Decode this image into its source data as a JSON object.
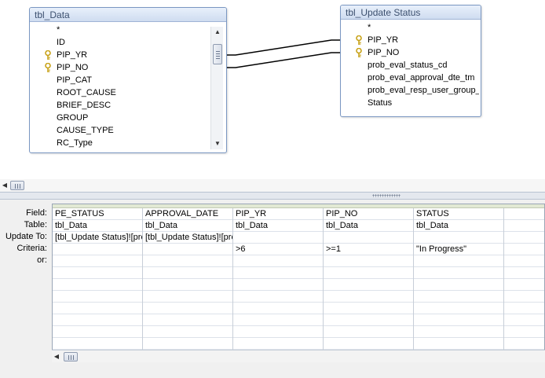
{
  "tables": [
    {
      "title": "tbl_Data",
      "fields": [
        {
          "name": "*",
          "key": false
        },
        {
          "name": "ID",
          "key": false
        },
        {
          "name": "PIP_YR",
          "key": true
        },
        {
          "name": "PIP_NO",
          "key": true
        },
        {
          "name": "PIP_CAT",
          "key": false
        },
        {
          "name": "ROOT_CAUSE",
          "key": false
        },
        {
          "name": "BRIEF_DESC",
          "key": false
        },
        {
          "name": "GROUP",
          "key": false
        },
        {
          "name": "CAUSE_TYPE",
          "key": false
        },
        {
          "name": "RC_Type",
          "key": false
        }
      ]
    },
    {
      "title": "tbl_Update Status",
      "fields": [
        {
          "name": "*",
          "key": false
        },
        {
          "name": "PIP_YR",
          "key": true
        },
        {
          "name": "PIP_NO",
          "key": true
        },
        {
          "name": "prob_eval_status_cd",
          "key": false
        },
        {
          "name": "prob_eval_approval_dte_tm",
          "key": false
        },
        {
          "name": "prob_eval_resp_user_group_",
          "key": false
        },
        {
          "name": "Status",
          "key": false
        }
      ]
    }
  ],
  "grid": {
    "row_labels": [
      "Field:",
      "Table:",
      "Update To:",
      "Criteria:",
      "or:"
    ],
    "columns": [
      {
        "field": "PE_STATUS",
        "table": "tbl_Data",
        "update_to": "[tbl_Update Status]![prob_eval_status_cd]",
        "criteria": "",
        "or": ""
      },
      {
        "field": "APPROVAL_DATE",
        "table": "tbl_Data",
        "update_to": "[tbl_Update Status]![prob_eval_approval_dte_tm]",
        "criteria": "",
        "or": ""
      },
      {
        "field": "PIP_YR",
        "table": "tbl_Data",
        "update_to": "",
        "criteria": ">6",
        "or": ""
      },
      {
        "field": "PIP_NO",
        "table": "tbl_Data",
        "update_to": "",
        "criteria": ">=1",
        "or": ""
      },
      {
        "field": "STATUS",
        "table": "tbl_Data",
        "update_to": "",
        "criteria": "\"In Progress\"",
        "or": ""
      },
      {
        "field": "",
        "table": "",
        "update_to": "",
        "criteria": "",
        "or": ""
      }
    ]
  },
  "colors": {
    "title_text": "#3b4f6e",
    "border": "#7a97c2",
    "grid_header": "#e2e9d4",
    "grid_pane_bg": "#f0f0f0",
    "key_icon": "#c8a31a"
  }
}
